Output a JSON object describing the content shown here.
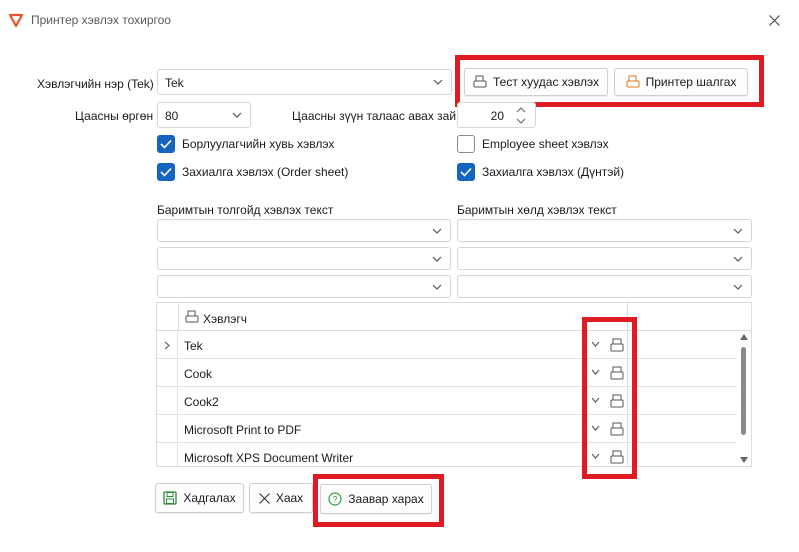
{
  "window": {
    "title": "Принтер хэвлэх тохиргоо"
  },
  "printer_name": {
    "label": "Хэвлэгчийн нэр (Tek)",
    "value": "Tek"
  },
  "buttons": {
    "test_page": "Тест хуудас хэвлэх",
    "check_printer": "Принтер шалгах",
    "save": "Хадгалах",
    "close": "Хаах",
    "help": "Заавар харах"
  },
  "paper_width": {
    "label": "Цаасны өргөн",
    "value": "80"
  },
  "paper_margin": {
    "label": "Цаасны зүүн талаас авах зай",
    "value": "20"
  },
  "checkboxes": [
    {
      "label": "Борлуулагчийн хувь хэвлэх",
      "checked": true
    },
    {
      "label": "Employee sheet хэвлэх",
      "checked": false
    },
    {
      "label": "Захиалга хэвлэх (Order sheet)",
      "checked": true
    },
    {
      "label": "Захиалга хэвлэх (Дүнтэй)",
      "checked": true
    }
  ],
  "header_text": {
    "label": "Баримтын толгойд хэвлэх текст"
  },
  "footer_text": {
    "label": "Баримтын хөлд хэвлэх текст"
  },
  "grid": {
    "column": "Хэвлэгч",
    "rows": [
      "Tek",
      "Cook",
      "Cook2",
      "Microsoft Print to PDF",
      "Microsoft XPS Document Writer"
    ]
  },
  "colors": {
    "highlight": "#e01b24",
    "checkbox": "#1565c0",
    "accent": "#e0791f",
    "save_icon": "#2e8b3a",
    "help_icon": "#2e9e44"
  }
}
